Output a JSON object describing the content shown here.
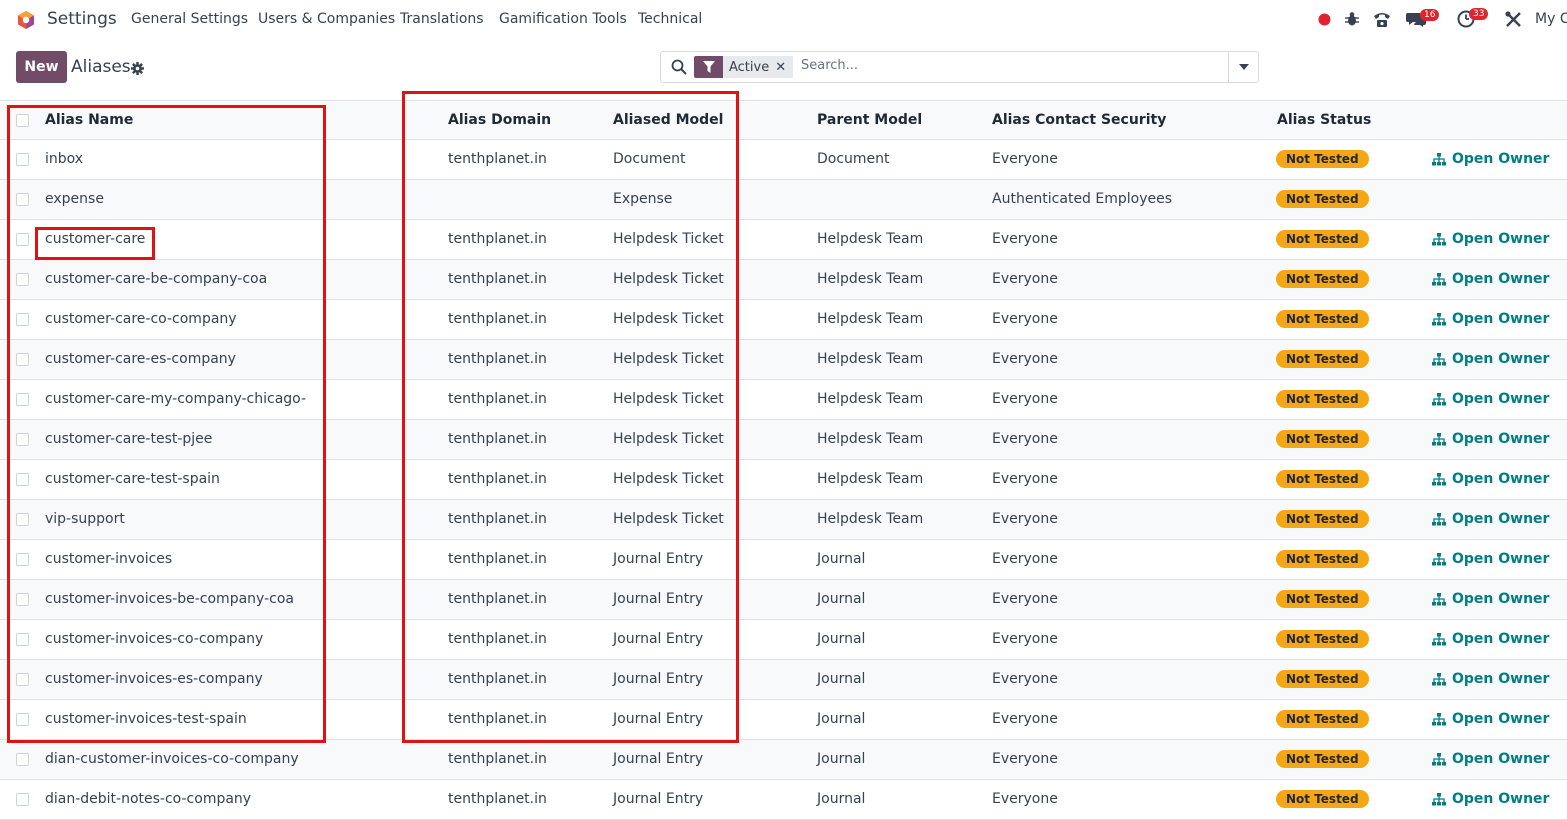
{
  "topbar": {
    "app_name": "Settings",
    "menu": [
      "General Settings",
      "Users & Companies",
      "Translations",
      "Gamification Tools",
      "Technical"
    ],
    "messages_count": "16",
    "activities_count": "33",
    "company": "My C"
  },
  "control_panel": {
    "new_label": "New",
    "breadcrumb": "Aliases",
    "search": {
      "facet": "Active",
      "placeholder": "Search..."
    }
  },
  "table": {
    "headers": {
      "alias_name": "Alias Name",
      "alias_domain": "Alias Domain",
      "aliased_model": "Aliased Model",
      "parent_model": "Parent Model",
      "contact_security": "Alias Contact Security",
      "status": "Alias Status"
    },
    "rows": [
      {
        "name": "inbox",
        "domain": "tenthplanet.in",
        "model": "Document",
        "parent": "Document",
        "security": "Everyone",
        "status": "Not Tested",
        "owner": "Open Owner"
      },
      {
        "name": "expense",
        "domain": "",
        "model": "Expense",
        "parent": "",
        "security": "Authenticated Employees",
        "status": "Not Tested",
        "owner": ""
      },
      {
        "name": "customer-care",
        "domain": "tenthplanet.in",
        "model": "Helpdesk Ticket",
        "parent": "Helpdesk Team",
        "security": "Everyone",
        "status": "Not Tested",
        "owner": "Open Owner"
      },
      {
        "name": "customer-care-be-company-coa",
        "domain": "tenthplanet.in",
        "model": "Helpdesk Ticket",
        "parent": "Helpdesk Team",
        "security": "Everyone",
        "status": "Not Tested",
        "owner": "Open Owner"
      },
      {
        "name": "customer-care-co-company",
        "domain": "tenthplanet.in",
        "model": "Helpdesk Ticket",
        "parent": "Helpdesk Team",
        "security": "Everyone",
        "status": "Not Tested",
        "owner": "Open Owner"
      },
      {
        "name": "customer-care-es-company",
        "domain": "tenthplanet.in",
        "model": "Helpdesk Ticket",
        "parent": "Helpdesk Team",
        "security": "Everyone",
        "status": "Not Tested",
        "owner": "Open Owner"
      },
      {
        "name": "customer-care-my-company-chicago-",
        "domain": "tenthplanet.in",
        "model": "Helpdesk Ticket",
        "parent": "Helpdesk Team",
        "security": "Everyone",
        "status": "Not Tested",
        "owner": "Open Owner"
      },
      {
        "name": "customer-care-test-pjee",
        "domain": "tenthplanet.in",
        "model": "Helpdesk Ticket",
        "parent": "Helpdesk Team",
        "security": "Everyone",
        "status": "Not Tested",
        "owner": "Open Owner"
      },
      {
        "name": "customer-care-test-spain",
        "domain": "tenthplanet.in",
        "model": "Helpdesk Ticket",
        "parent": "Helpdesk Team",
        "security": "Everyone",
        "status": "Not Tested",
        "owner": "Open Owner"
      },
      {
        "name": "vip-support",
        "domain": "tenthplanet.in",
        "model": "Helpdesk Ticket",
        "parent": "Helpdesk Team",
        "security": "Everyone",
        "status": "Not Tested",
        "owner": "Open Owner"
      },
      {
        "name": "customer-invoices",
        "domain": "tenthplanet.in",
        "model": "Journal Entry",
        "parent": "Journal",
        "security": "Everyone",
        "status": "Not Tested",
        "owner": "Open Owner"
      },
      {
        "name": "customer-invoices-be-company-coa",
        "domain": "tenthplanet.in",
        "model": "Journal Entry",
        "parent": "Journal",
        "security": "Everyone",
        "status": "Not Tested",
        "owner": "Open Owner"
      },
      {
        "name": "customer-invoices-co-company",
        "domain": "tenthplanet.in",
        "model": "Journal Entry",
        "parent": "Journal",
        "security": "Everyone",
        "status": "Not Tested",
        "owner": "Open Owner"
      },
      {
        "name": "customer-invoices-es-company",
        "domain": "tenthplanet.in",
        "model": "Journal Entry",
        "parent": "Journal",
        "security": "Everyone",
        "status": "Not Tested",
        "owner": "Open Owner"
      },
      {
        "name": "customer-invoices-test-spain",
        "domain": "tenthplanet.in",
        "model": "Journal Entry",
        "parent": "Journal",
        "security": "Everyone",
        "status": "Not Tested",
        "owner": "Open Owner"
      },
      {
        "name": "dian-customer-invoices-co-company",
        "domain": "tenthplanet.in",
        "model": "Journal Entry",
        "parent": "Journal",
        "security": "Everyone",
        "status": "Not Tested",
        "owner": "Open Owner"
      },
      {
        "name": "dian-debit-notes-co-company",
        "domain": "tenthplanet.in",
        "model": "Journal Entry",
        "parent": "Journal",
        "security": "Everyone",
        "status": "Not Tested",
        "owner": "Open Owner"
      }
    ]
  },
  "colors": {
    "brand": "#714b67",
    "status_badge": "#f3a712",
    "link": "#017e84",
    "annotation": "#e01212"
  }
}
